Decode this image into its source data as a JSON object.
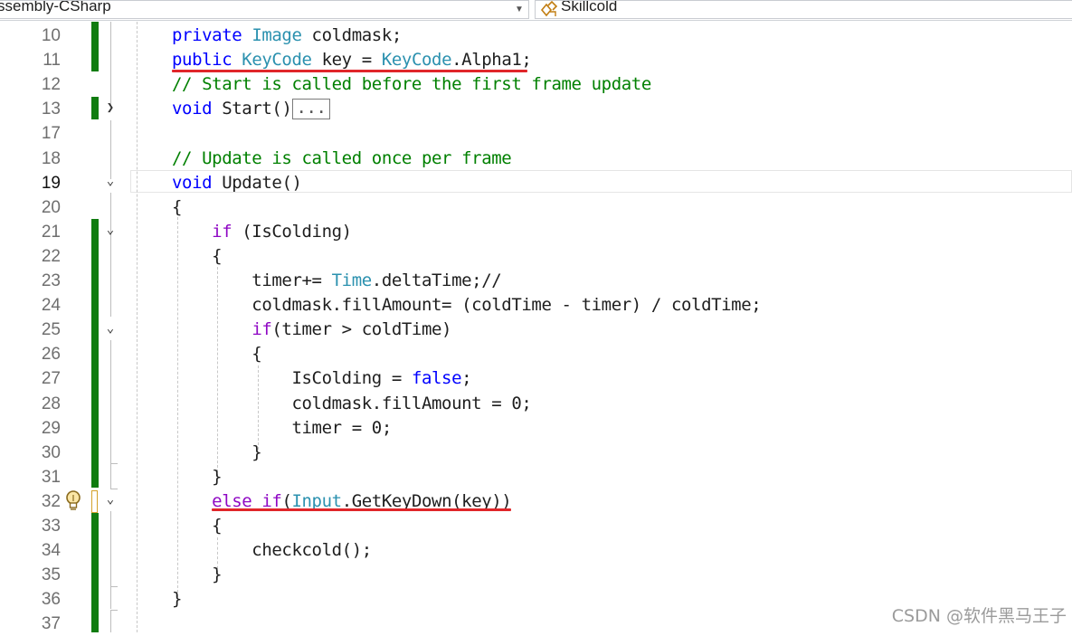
{
  "navigation_bar": {
    "project_dropdown": "ssembly-CSharp",
    "member_dropdown": "Skillcold"
  },
  "editor": {
    "lines": [
      {
        "n": "10",
        "parts": [
          {
            "t": "private ",
            "c": "kw"
          },
          {
            "t": "Image",
            "c": "type"
          },
          {
            "t": " coldmask;",
            "c": "plain"
          }
        ]
      },
      {
        "n": "11",
        "parts": [
          {
            "t": "public ",
            "c": "kw"
          },
          {
            "t": "KeyCode",
            "c": "type"
          },
          {
            "t": " ",
            "c": "plain"
          },
          {
            "t": "key",
            "c": "plain"
          },
          {
            "t": " = ",
            "c": "plain"
          },
          {
            "t": "KeyCode",
            "c": "type"
          },
          {
            "t": ".Alpha1;",
            "c": "plain"
          }
        ]
      },
      {
        "n": "12",
        "parts": [
          {
            "t": "// Start is called before the first frame update",
            "c": "cmt"
          }
        ]
      },
      {
        "n": "13",
        "parts": [
          {
            "t": "void ",
            "c": "kw"
          },
          {
            "t": "Start",
            "c": "plain"
          },
          {
            "t": "()",
            "c": "plain"
          }
        ],
        "collapsed": "..."
      },
      {
        "n": "17",
        "parts": []
      },
      {
        "n": "18",
        "parts": [
          {
            "t": "// Update is called once per frame",
            "c": "cmt"
          }
        ]
      },
      {
        "n": "19",
        "parts": [
          {
            "t": "void ",
            "c": "kw"
          },
          {
            "t": "Update",
            "c": "plain"
          },
          {
            "t": "()",
            "c": "plain"
          }
        ]
      },
      {
        "n": "20",
        "parts": [
          {
            "t": "{",
            "c": "plain"
          }
        ]
      },
      {
        "n": "21",
        "parts": [
          {
            "t": "    ",
            "c": "plain"
          },
          {
            "t": "if",
            "c": "kw-ctrl"
          },
          {
            "t": " (IsColding)",
            "c": "plain"
          }
        ]
      },
      {
        "n": "22",
        "parts": [
          {
            "t": "    {",
            "c": "plain"
          }
        ]
      },
      {
        "n": "23",
        "parts": [
          {
            "t": "        timer+= ",
            "c": "plain"
          },
          {
            "t": "Time",
            "c": "type"
          },
          {
            "t": ".deltaTime;//",
            "c": "plain"
          }
        ]
      },
      {
        "n": "24",
        "parts": [
          {
            "t": "        coldmask.fillAmount= (coldTime - timer) / coldTime;",
            "c": "plain"
          }
        ]
      },
      {
        "n": "25",
        "parts": [
          {
            "t": "        ",
            "c": "plain"
          },
          {
            "t": "if",
            "c": "kw-ctrl"
          },
          {
            "t": "(timer > coldTime)",
            "c": "plain"
          }
        ]
      },
      {
        "n": "26",
        "parts": [
          {
            "t": "        {",
            "c": "plain"
          }
        ]
      },
      {
        "n": "27",
        "parts": [
          {
            "t": "            IsColding = ",
            "c": "plain"
          },
          {
            "t": "false",
            "c": "kw"
          },
          {
            "t": ";",
            "c": "plain"
          }
        ]
      },
      {
        "n": "28",
        "parts": [
          {
            "t": "            coldmask.fillAmount = 0;",
            "c": "plain"
          }
        ]
      },
      {
        "n": "29",
        "parts": [
          {
            "t": "            timer = 0;",
            "c": "plain"
          }
        ]
      },
      {
        "n": "30",
        "parts": [
          {
            "t": "        }",
            "c": "plain"
          }
        ]
      },
      {
        "n": "31",
        "parts": [
          {
            "t": "    }",
            "c": "plain"
          }
        ]
      },
      {
        "n": "32",
        "parts": [
          {
            "t": "    ",
            "c": "plain"
          },
          {
            "t": "else",
            "c": "kw-ctrl"
          },
          {
            "t": " ",
            "c": "plain"
          },
          {
            "t": "if",
            "c": "kw-ctrl"
          },
          {
            "t": "(",
            "c": "plain"
          },
          {
            "t": "Input",
            "c": "type"
          },
          {
            "t": ".GetKeyDown(key))",
            "c": "plain"
          }
        ]
      },
      {
        "n": "33",
        "parts": [
          {
            "t": "    {",
            "c": "plain"
          }
        ]
      },
      {
        "n": "34",
        "parts": [
          {
            "t": "        checkcold();",
            "c": "plain"
          }
        ]
      },
      {
        "n": "35",
        "parts": [
          {
            "t": "    }",
            "c": "plain"
          }
        ]
      },
      {
        "n": "36",
        "parts": [
          {
            "t": "}",
            "c": "plain"
          }
        ]
      },
      {
        "n": "37",
        "parts": []
      }
    ]
  },
  "watermark": "CSDN @软件黑马王子",
  "colors": {
    "keyword": "#0000ff",
    "control_keyword": "#8f08c4",
    "type": "#2b91af",
    "comment": "#008000",
    "change_bar": "#107c10",
    "red_underline": "#e0262a"
  }
}
